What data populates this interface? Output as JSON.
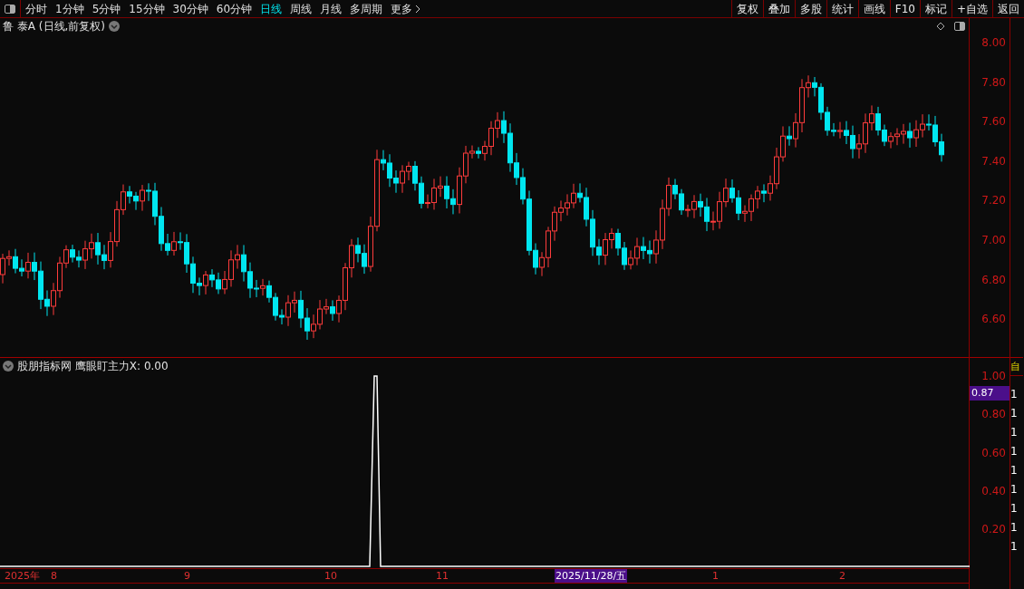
{
  "toolbar": {
    "periods": [
      {
        "label": "分时",
        "selected": false
      },
      {
        "label": "1分钟",
        "selected": false
      },
      {
        "label": "5分钟",
        "selected": false
      },
      {
        "label": "15分钟",
        "selected": false
      },
      {
        "label": "30分钟",
        "selected": false
      },
      {
        "label": "60分钟",
        "selected": false
      },
      {
        "label": "日线",
        "selected": true
      },
      {
        "label": "周线",
        "selected": false
      },
      {
        "label": "月线",
        "selected": false
      },
      {
        "label": "多周期",
        "selected": false
      },
      {
        "label": "更多",
        "selected": false
      }
    ],
    "buttons": [
      "复权",
      "叠加",
      "多股",
      "统计",
      "画线",
      "F10",
      "标记",
      "+自选",
      "返回"
    ]
  },
  "chart_header": {
    "title": "鲁 泰A (日线,前复权)"
  },
  "price_axis": {
    "ticks": [
      "8.00",
      "7.80",
      "7.60",
      "7.40",
      "7.20",
      "7.00",
      "6.80",
      "6.60"
    ]
  },
  "indicator": {
    "title": "股朋指标网 鹰眼盯主力X: 0.00",
    "ticks": [
      "1.00",
      "0.80",
      "0.60",
      "0.40",
      "0.20"
    ],
    "current": "0.87"
  },
  "date_axis": {
    "labels": [
      {
        "label": "2025年",
        "selected": false
      },
      {
        "label": "8",
        "selected": false
      },
      {
        "label": "9",
        "selected": false
      },
      {
        "label": "10",
        "selected": false
      },
      {
        "label": "11",
        "selected": false
      },
      {
        "label": "2025/11/28/五",
        "selected": true
      },
      {
        "label": "1",
        "selected": false
      },
      {
        "label": "2",
        "selected": false
      }
    ]
  },
  "side_strip": {
    "top": "自",
    "items": [
      "1",
      "1",
      "1",
      "1",
      "1",
      "1",
      "1",
      "1",
      "1"
    ]
  }
}
